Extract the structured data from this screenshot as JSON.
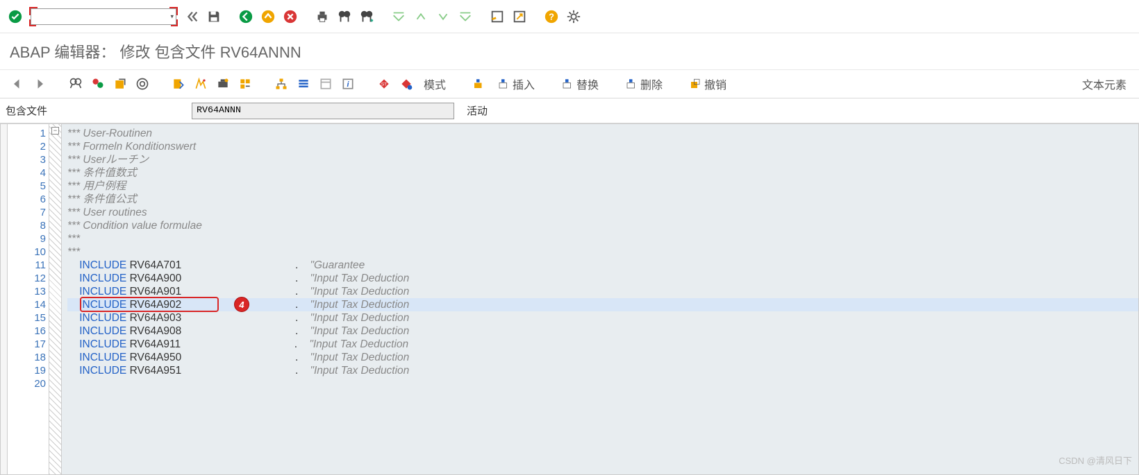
{
  "title": "ABAP 编辑器： 修改 包含文件 RV64ANNN",
  "cmd_value": "",
  "filter": {
    "label": "包含文件",
    "value": "RV64ANNN",
    "status": "活动"
  },
  "app_toolbar": {
    "pattern": "模式",
    "insert": "插入",
    "replace": "替换",
    "delete": "删除",
    "undo": "撤销",
    "text_elem": "文本元素"
  },
  "callout": "4",
  "watermark": "CSDN @清风日下",
  "code": [
    {
      "n": 1,
      "type": "c",
      "text": "*** User-Routinen"
    },
    {
      "n": 2,
      "type": "c",
      "text": "*** Formeln Konditionswert"
    },
    {
      "n": 3,
      "type": "c",
      "text": "*** Userルーチン"
    },
    {
      "n": 4,
      "type": "c",
      "text": "*** 条件值数式"
    },
    {
      "n": 5,
      "type": "c",
      "text": "*** 用户例程"
    },
    {
      "n": 6,
      "type": "c",
      "text": "*** 条件值公式"
    },
    {
      "n": 7,
      "type": "c",
      "text": "*** User routines"
    },
    {
      "n": 8,
      "type": "c",
      "text": "*** Condition value formulae"
    },
    {
      "n": 9,
      "type": "c",
      "text": "***"
    },
    {
      "n": 10,
      "type": "c",
      "text": "***"
    },
    {
      "n": 11,
      "type": "i",
      "inc": "RV64A701",
      "desc": "\"Guarantee"
    },
    {
      "n": 12,
      "type": "i",
      "inc": "RV64A900",
      "desc": "\"Input Tax Deduction"
    },
    {
      "n": 13,
      "type": "i",
      "inc": "RV64A901",
      "desc": "\"Input Tax Deduction"
    },
    {
      "n": 14,
      "type": "i",
      "inc": "RV64A902",
      "desc": "\"Input Tax Deduction",
      "hl": true
    },
    {
      "n": 15,
      "type": "i",
      "inc": "RV64A903",
      "desc": "\"Input Tax Deduction"
    },
    {
      "n": 16,
      "type": "i",
      "inc": "RV64A908",
      "desc": "\"Input Tax Deduction"
    },
    {
      "n": 17,
      "type": "i",
      "inc": "RV64A911",
      "desc": "\"Input Tax Deduction"
    },
    {
      "n": 18,
      "type": "i",
      "inc": "RV64A950",
      "desc": "\"Input Tax Deduction"
    },
    {
      "n": 19,
      "type": "i",
      "inc": "RV64A951",
      "desc": "\"Input Tax Deduction"
    },
    {
      "n": 20,
      "type": "e",
      "text": ""
    }
  ]
}
